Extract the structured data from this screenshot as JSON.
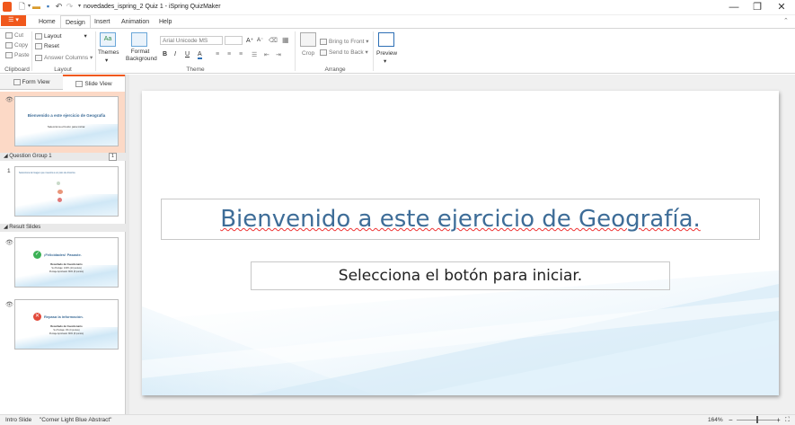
{
  "window": {
    "title": "novedades_ispring_2 Quiz 1 - iSpring QuizMaker",
    "minimize": "—",
    "maximize": "❐",
    "close": "✕"
  },
  "file_tab": {
    "label": "☰ ▾"
  },
  "tabs": [
    {
      "label": "Home"
    },
    {
      "label": "Design"
    },
    {
      "label": "Insert"
    },
    {
      "label": "Animation"
    },
    {
      "label": "Help"
    }
  ],
  "ribbon": {
    "clipboard": {
      "cut": "Cut",
      "copy": "Copy",
      "paste": "Paste",
      "label": "Clipboard"
    },
    "layout": {
      "layout": "Layout",
      "reset": "Reset",
      "answer_columns": "Answer Columns",
      "label": "Layout"
    },
    "themes": {
      "themes": "Themes",
      "format_background": "Format Background",
      "font": "Arial Unicode MS",
      "font_size": "",
      "label": "Theme"
    },
    "arrange": {
      "crop": "Crop",
      "bring_to_front": "Bring to Front",
      "send_to_back": "Send to Back",
      "label": "Arrange"
    },
    "preview": {
      "label": "Preview"
    }
  },
  "view_tabs": {
    "form_view": "Form View",
    "slide_view": "Slide View"
  },
  "slides_panel": {
    "intro": {
      "title": "Bienvenido a este ejercicio de Geografía",
      "subtitle": "Selecciona el botón para iniciar."
    },
    "group1": {
      "label": "Question Group 1",
      "count": "1",
      "slide_num": "1",
      "question": "Selecciona la imagen que muestra a un país de América"
    },
    "result_label": "Result Slides",
    "pass": {
      "title": "¡Felicidades! Pasaste.",
      "results": "Resultado de Cuestionario",
      "score": "Su Puntaje: 100% (10 puntos)",
      "passing": "Puntaje Aprobado: 80% (8 puntos)"
    },
    "fail": {
      "title": "Repasa la información.",
      "results": "Resultado de Cuestionario",
      "score": "Su Puntaje: 0% (0 puntos)",
      "passing": "Puntaje Aprobado: 80% (8 puntos)"
    }
  },
  "slide": {
    "title": "Bienvenido a este ejercicio de Geografía.",
    "subtitle": "Selecciona el botón para iniciar."
  },
  "status": {
    "slide_type": "Intro Slide",
    "theme": "\"Corner Light Blue Abstract\"",
    "zoom": "164%"
  },
  "colors": {
    "accent": "#f0581c",
    "title_blue": "#3e6d98",
    "selected_bg": "#fcd9c6"
  }
}
